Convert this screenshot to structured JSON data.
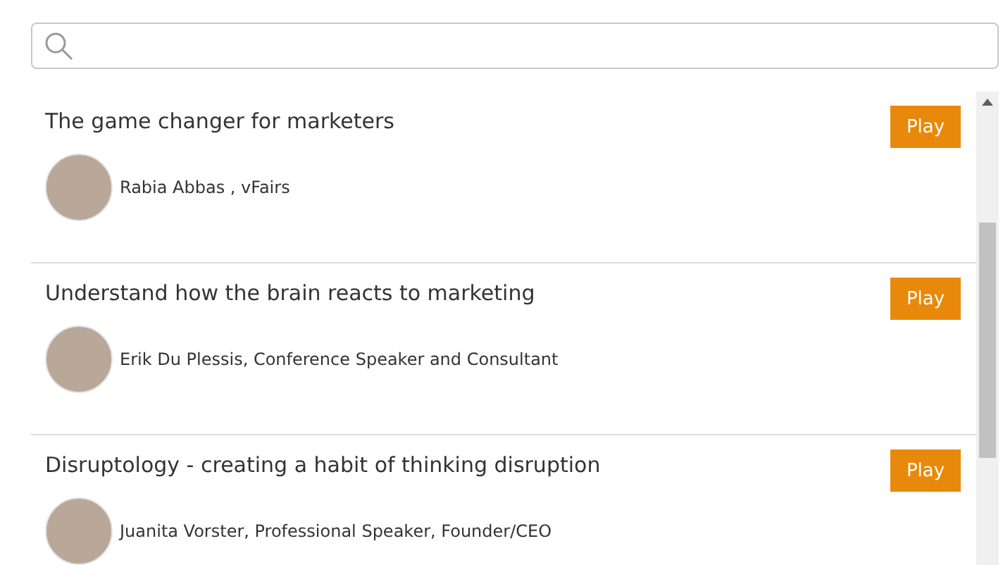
{
  "sessions": [
    {
      "title": "The game changer for marketers",
      "speaker": "Rabia Abbas , vFairs",
      "button": "Play"
    },
    {
      "title": "Understand how the brain reacts to marketing",
      "speaker": "Erik Du Plessis, Conference Speaker and Consultant",
      "button": "Play"
    },
    {
      "title": "Disruptology - creating a habit of thinking disruption",
      "speaker": "Juanita Vorster, Professional Speaker, Founder/CEO",
      "button": "Play"
    }
  ]
}
